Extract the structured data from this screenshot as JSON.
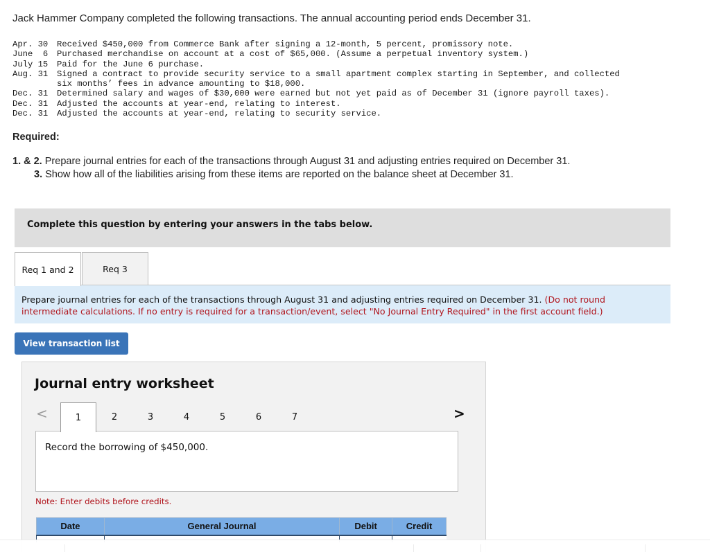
{
  "intro": "Jack Hammer Company completed the following transactions. The annual accounting period ends December 31.",
  "transactions": [
    {
      "date": "Apr. 30",
      "desc": "Received $450,000 from Commerce Bank after signing a 12-month, 5 percent, promissory note."
    },
    {
      "date": "June  6",
      "desc": "Purchased merchandise on account at a cost of $65,000. (Assume a perpetual inventory system.)"
    },
    {
      "date": "July 15",
      "desc": "Paid for the June 6 purchase."
    },
    {
      "date": "Aug. 31",
      "desc": "Signed a contract to provide security service to a small apartment complex starting in September, and collected\nsix months’ fees in advance amounting to $18,000."
    },
    {
      "date": "Dec. 31",
      "desc": "Determined salary and wages of $30,000 were earned but not yet paid as of December 31 (ignore payroll taxes)."
    },
    {
      "date": "Dec. 31",
      "desc": "Adjusted the accounts at year-end, relating to interest."
    },
    {
      "date": "Dec. 31",
      "desc": "Adjusted the accounts at year-end, relating to security service."
    }
  ],
  "required": {
    "label": "Required:",
    "items": [
      {
        "num": "1. & 2.",
        "text": "Prepare journal entries for each of the transactions through August 31 and adjusting entries required on December 31."
      },
      {
        "num": "3.",
        "text": "Show how all of the liabilities arising from these items are reported on the balance sheet at December 31."
      }
    ]
  },
  "complete_box": "Complete this question by entering your answers in the tabs below.",
  "tabs": [
    {
      "label": "Req 1 and 2",
      "active": true
    },
    {
      "label": "Req 3",
      "active": false
    }
  ],
  "instructions": {
    "main": "Prepare journal entries for each of the transactions through August 31 and adjusting entries required on December 31.",
    "note": "(Do not round intermediate calculations. If no entry is required for a transaction/event, select \"No Journal Entry Required\" in the first account field.)"
  },
  "view_button": "View transaction list",
  "worksheet": {
    "title": "Journal entry worksheet",
    "pages": [
      "1",
      "2",
      "3",
      "4",
      "5",
      "6",
      "7"
    ],
    "active_page": "1",
    "prev_icon": "<",
    "next_icon": ">",
    "prompt": "Record the borrowing of $450,000.",
    "note": "Note: Enter debits before credits.",
    "columns": [
      "Date",
      "General Journal",
      "Debit",
      "Credit"
    ]
  }
}
